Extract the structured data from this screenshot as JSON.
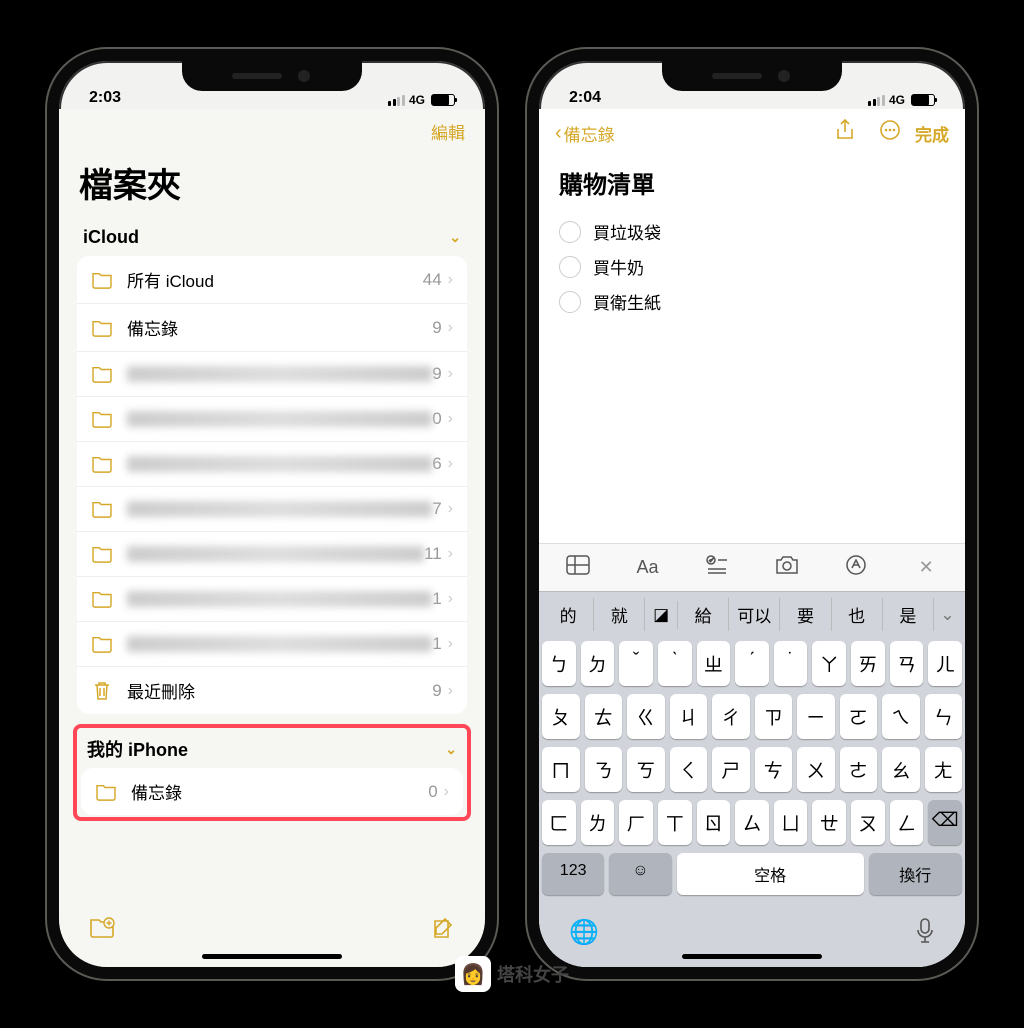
{
  "phone1": {
    "status": {
      "time": "2:03",
      "network": "4G"
    },
    "nav": {
      "edit": "編輯"
    },
    "title": "檔案夾",
    "sections": {
      "icloud": {
        "header": "iCloud",
        "folders": [
          {
            "name": "所有 iCloud",
            "count": "44",
            "blurred": false
          },
          {
            "name": "備忘錄",
            "count": "9",
            "blurred": false
          },
          {
            "name": "",
            "count": "9",
            "blurred": true
          },
          {
            "name": "",
            "count": "0",
            "blurred": true
          },
          {
            "name": "",
            "count": "6",
            "blurred": true
          },
          {
            "name": "",
            "count": "7",
            "blurred": true
          },
          {
            "name": "",
            "count": "11",
            "blurred": true
          },
          {
            "name": "",
            "count": "1",
            "blurred": true
          },
          {
            "name": "",
            "count": "1",
            "blurred": true
          }
        ],
        "trash": {
          "name": "最近刪除",
          "count": "9"
        }
      },
      "myiphone": {
        "header": "我的 iPhone",
        "folders": [
          {
            "name": "備忘錄",
            "count": "0"
          }
        ]
      }
    }
  },
  "phone2": {
    "status": {
      "time": "2:04",
      "network": "4G"
    },
    "nav": {
      "back": "備忘錄",
      "done": "完成"
    },
    "noteTitle": "購物清單",
    "checklist": [
      "買垃圾袋",
      "買牛奶",
      "買衛生紙"
    ],
    "suggestions": [
      "的",
      "就",
      "給",
      "可以",
      "要",
      "也",
      "是"
    ],
    "keyboard": {
      "row1": [
        "ㄅ",
        "ㄉ",
        "ˇ",
        "ˋ",
        "ㄓ",
        "ˊ",
        "˙",
        "ㄚ",
        "ㄞ",
        "ㄢ",
        "ㄦ"
      ],
      "row2": [
        "ㄆ",
        "ㄊ",
        "ㄍ",
        "ㄐ",
        "ㄔ",
        "ㄗ",
        "ㄧ",
        "ㄛ",
        "ㄟ",
        "ㄣ"
      ],
      "row3": [
        "ㄇ",
        "ㄋ",
        "ㄎ",
        "ㄑ",
        "ㄕ",
        "ㄘ",
        "ㄨ",
        "ㄜ",
        "ㄠ",
        "ㄤ"
      ],
      "row4": [
        "ㄈ",
        "ㄌ",
        "ㄏ",
        "ㄒ",
        "ㄖ",
        "ㄙ",
        "ㄩ",
        "ㄝ",
        "ㄡ",
        "ㄥ"
      ],
      "numKey": "123",
      "space": "空格",
      "return": "換行"
    }
  },
  "watermark": "塔科女子"
}
